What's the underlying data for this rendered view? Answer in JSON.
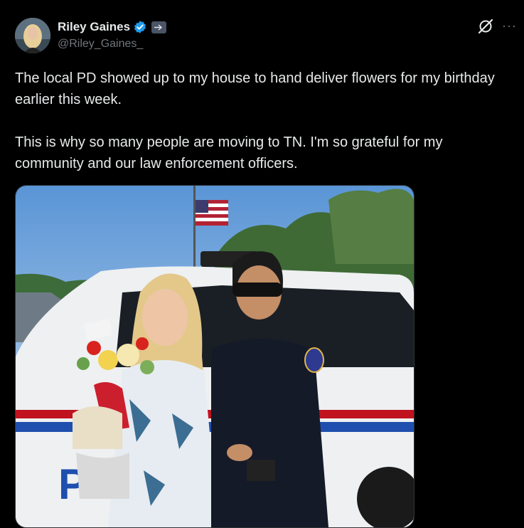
{
  "author": {
    "display_name": "Riley Gaines",
    "handle": "@Riley_Gaines_",
    "verified": true,
    "verified_icon": "verified-badge-icon",
    "affiliation_icon": "affiliation-badge-icon"
  },
  "post": {
    "paragraphs": [
      "The local PD showed up to my house to hand deliver flowers for my birthday earlier this week.",
      "This is why so many people are moving to TN. I'm so grateful for my community and our law enforcement officers."
    ]
  },
  "actions": {
    "grok_icon": "grok-icon",
    "more_label": "···"
  },
  "colors": {
    "background": "#000000",
    "text": "#e7e9ea",
    "secondary": "#71767b",
    "verified_blue": "#1d9bf0"
  }
}
